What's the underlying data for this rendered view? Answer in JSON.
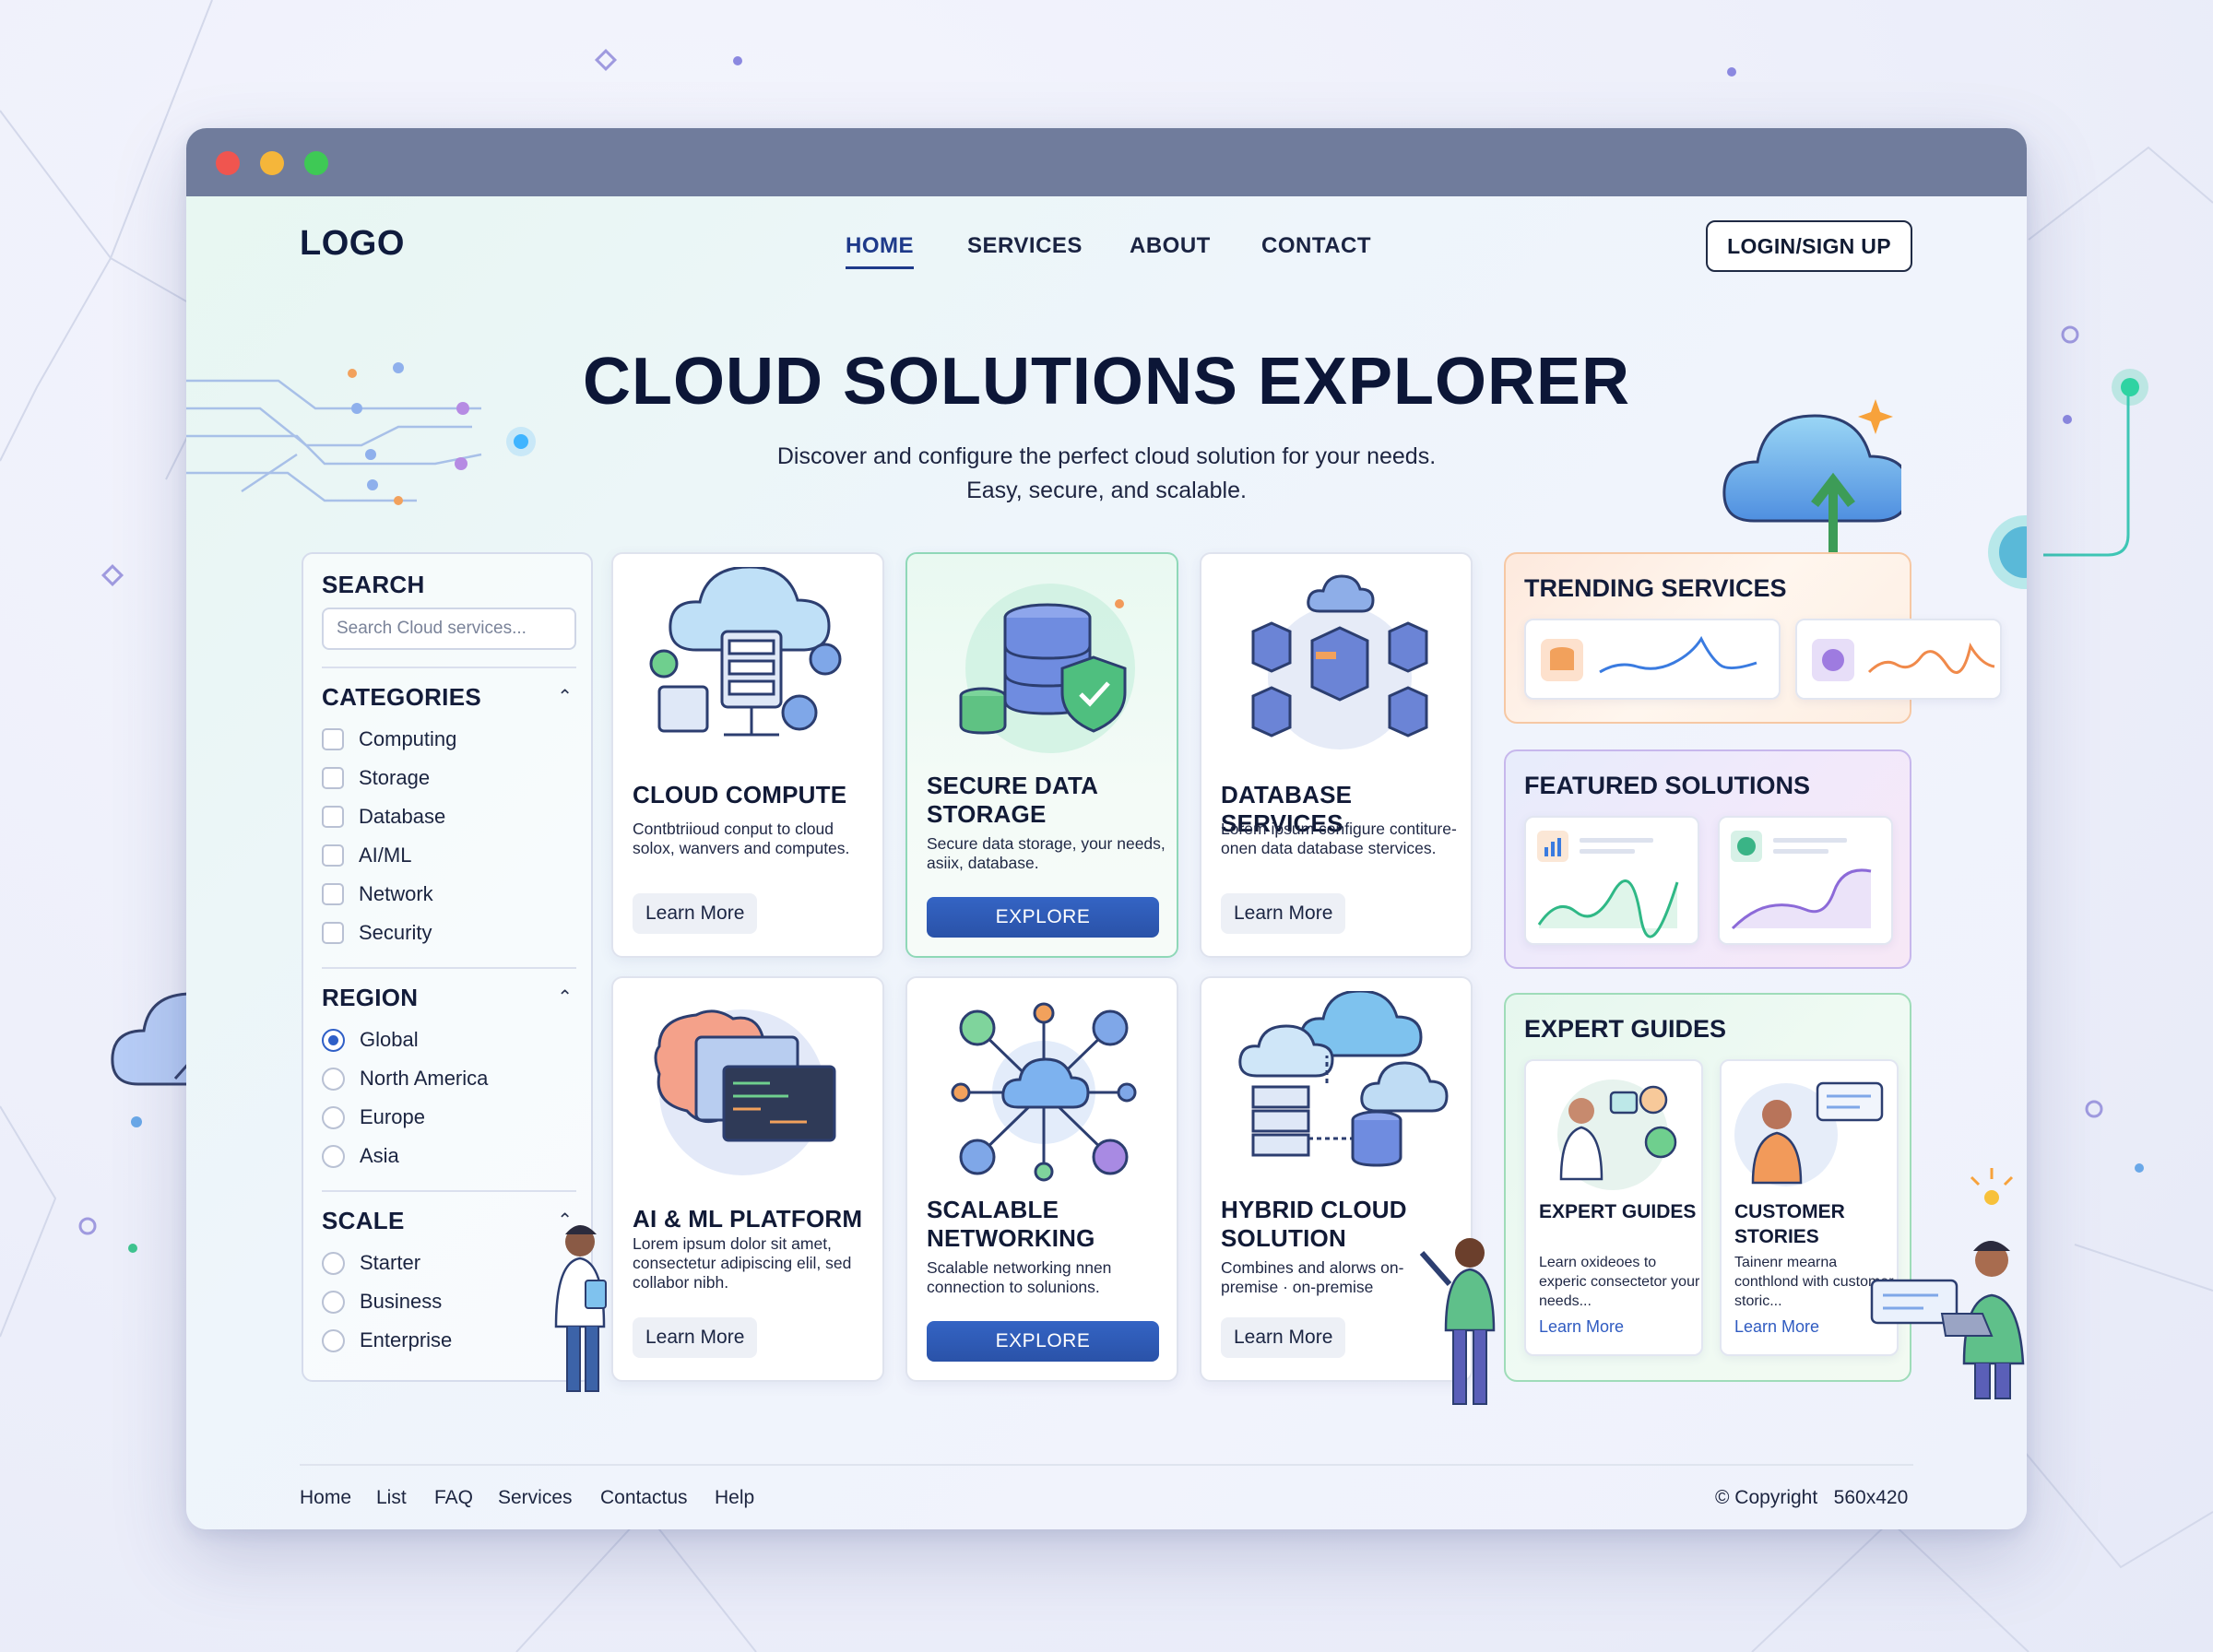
{
  "nav": {
    "logo": "LOGO",
    "items": [
      "HOME",
      "SERVICES",
      "ABOUT",
      "CONTACT"
    ],
    "active": "HOME",
    "login": "LOGIN/SIGN UP"
  },
  "hero": {
    "title": "CLOUD SOLUTIONS EXPLORER",
    "subtitle_line1": "Discover and configure the perfect cloud solution for your needs.",
    "subtitle_line2": "Easy, secure, and scalable."
  },
  "sidebar": {
    "search": {
      "title": "SEARCH",
      "placeholder": "Search Cloud services..."
    },
    "categories": {
      "title": "CATEGORIES",
      "options": [
        "Computing",
        "Storage",
        "Database",
        "AI/ML",
        "Network",
        "Security"
      ]
    },
    "region": {
      "title": "REGION",
      "options": [
        "Global",
        "North America",
        "Europe",
        "Asia"
      ],
      "selected": "Global"
    },
    "scale": {
      "title": "SCALE",
      "options": [
        "Starter",
        "Business",
        "Enterprise"
      ]
    }
  },
  "cards": [
    {
      "title": "CLOUD COMPUTE",
      "desc": "Contbtriioud conput to cloud solox, wanvers and computes.",
      "button": "Learn More",
      "icon": "cloud-compute-icon"
    },
    {
      "title": "SECURE DATA STORAGE",
      "desc": "Secure data storage, your needs, asiix, database.",
      "button": "EXPLORE",
      "icon": "secure-storage-icon"
    },
    {
      "title": "DATABASE SERVICES",
      "desc": "Lorem ipsum configure contiture-onen data database stervices.",
      "button": "Learn More",
      "icon": "database-icon"
    },
    {
      "title": "AI & ML PLATFORM",
      "desc": "Lorem ipsum dolor sit amet, consectetur adipiscing elil, sed collabor nibh.",
      "button": "Learn More",
      "icon": "ai-brain-icon"
    },
    {
      "title": "SCALABLE NETWORKING",
      "desc": "Scalable networking nnen connection to solunions.",
      "button": "EXPLORE",
      "icon": "network-icon"
    },
    {
      "title": "HYBRID CLOUD SOLUTION",
      "desc": "Combines and alorws on-premise · on-premise",
      "button": "Learn More",
      "icon": "hybrid-cloud-icon"
    }
  ],
  "trending": {
    "title": "TRENDING SERVICES"
  },
  "featured": {
    "title": "FEATURED SOLUTIONS"
  },
  "guides": {
    "title": "EXPERT GUIDES",
    "items": [
      {
        "title": "EXPERT GUIDES",
        "desc": "Learn oxideoes to experic consectetor your needs...",
        "link": "Learn More"
      },
      {
        "title": "CUSTOMER STORIES",
        "desc": "Tainenr mearna conthlond with customer storic...",
        "link": "Learn More"
      }
    ]
  },
  "footer": {
    "links": [
      "Home",
      "List",
      "FAQ",
      "Services",
      "Contactus",
      "Help"
    ],
    "copyright": "© Copyright   560x420"
  },
  "colors": {
    "accent": "#2f5fc7",
    "titlebar": "#707c9c",
    "dark": "#0c1637"
  }
}
